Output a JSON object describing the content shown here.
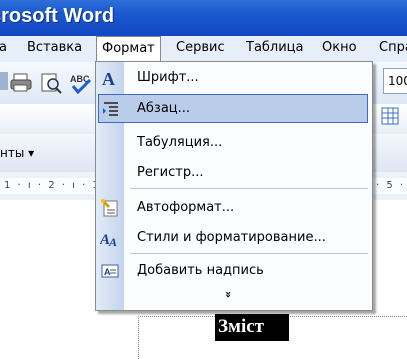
{
  "window": {
    "title": "crosoft Word"
  },
  "menubar": {
    "items": [
      {
        "label": "а",
        "key": "a"
      },
      {
        "label": "Вставка",
        "underline": "В"
      },
      {
        "label": "Формат",
        "underline": "Ф",
        "active": true
      },
      {
        "label": "Сервис",
        "underline": "С"
      },
      {
        "label": "Таблица",
        "underline": "Т"
      },
      {
        "label": "Окно",
        "underline": "О"
      },
      {
        "label": "Спра",
        "underline": "С"
      }
    ]
  },
  "toolbar": {
    "zoom_text": "100",
    "styles_label": "нты ▾"
  },
  "ruler": {
    "left_text": "1 · ı · 2 · ı · 1",
    "right_text": "· 5 ·"
  },
  "format_menu": {
    "items": [
      {
        "label": "Шрифт...",
        "icon": "font-icon"
      },
      {
        "label": "Абзац...",
        "icon": "paragraph-icon",
        "highlighted": true
      },
      {
        "label": "Табуляция...",
        "icon": ""
      },
      {
        "label": "Регистр...",
        "icon": ""
      },
      {
        "label": "Автоформат...",
        "icon": "autoformat-icon"
      },
      {
        "label": "Стили и форматирование...",
        "icon": "styles-icon"
      },
      {
        "label": "Добавить надпись",
        "icon": "textbox-icon"
      }
    ],
    "expand": "»"
  },
  "document": {
    "heading": "Зміст"
  },
  "colors": {
    "titlebar": "#1c5ad0",
    "menubar": "#e6eefa",
    "highlight": "#b9cdea"
  }
}
